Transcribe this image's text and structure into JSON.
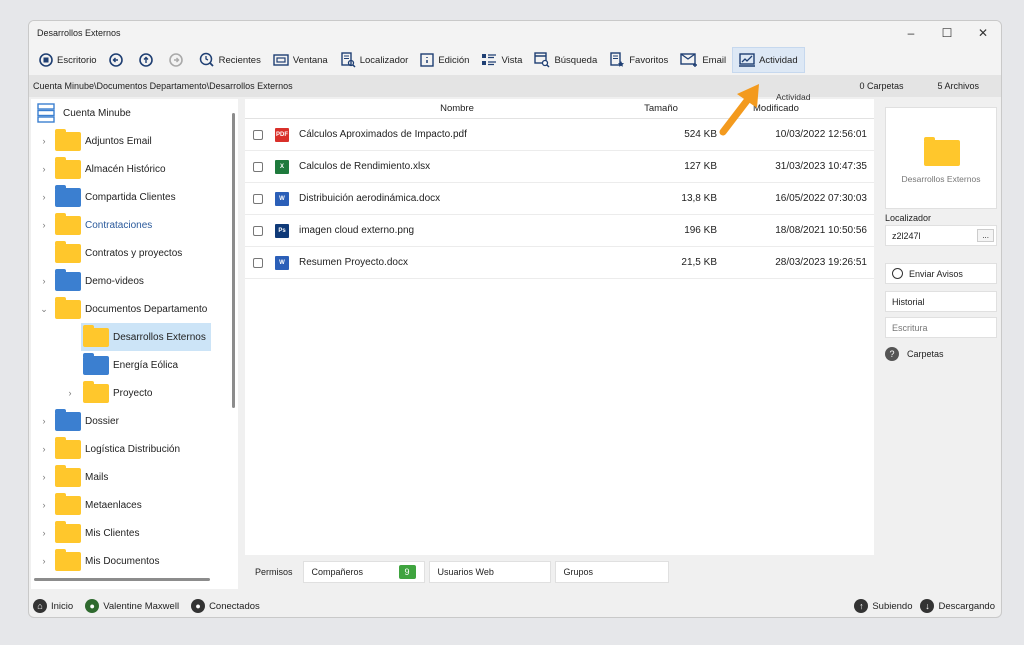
{
  "window": {
    "title": "Desarrollos Externos"
  },
  "toolbar": {
    "escritorio": "Escritorio",
    "recientes": "Recientes",
    "ventana": "Ventana",
    "localizador": "Localizador",
    "edicion": "Edición",
    "vista": "Vista",
    "busqueda": "Búsqueda",
    "favoritos": "Favoritos",
    "email": "Email",
    "actividad": "Actividad"
  },
  "tooltip": "Actividad",
  "path": {
    "text": "Cuenta Minube\\Documentos Departamento\\Desarrollos Externos",
    "carpetas": "0 Carpetas",
    "archivos": "5 Archivos"
  },
  "tree": {
    "root": "Cuenta Minube",
    "items": [
      {
        "label": "Adjuntos Email",
        "color": "y"
      },
      {
        "label": "Almacén Histórico",
        "color": "y"
      },
      {
        "label": "Compartida Clientes",
        "color": "b"
      },
      {
        "label": "Contrataciones",
        "color": "y"
      },
      {
        "label": "Contratos y proyectos",
        "color": "y"
      },
      {
        "label": "Demo-videos",
        "color": "b"
      },
      {
        "label": "Documentos Departamento",
        "color": "y"
      },
      {
        "label": "Desarrollos Externos",
        "color": "y"
      },
      {
        "label": "Energía Eólica",
        "color": "b"
      },
      {
        "label": "Proyecto",
        "color": "y"
      },
      {
        "label": "Dossier",
        "color": "b"
      },
      {
        "label": "Logística Distribución",
        "color": "y"
      },
      {
        "label": "Mails",
        "color": "y"
      },
      {
        "label": "Metaenlaces",
        "color": "y"
      },
      {
        "label": "Mis Clientes",
        "color": "y"
      },
      {
        "label": "Mis Documentos",
        "color": "y"
      }
    ]
  },
  "files": {
    "headers": {
      "name": "Nombre",
      "size": "Tamaño",
      "modified": "Modificado"
    },
    "rows": [
      {
        "name": "Cálculos Aproximados de Impacto.pdf",
        "size": "524 KB",
        "date": "10/03/2022 12:56:01",
        "type": "pdf"
      },
      {
        "name": "Calculos de Rendimiento.xlsx",
        "size": "127 KB",
        "date": "31/03/2023 10:47:35",
        "type": "xlsx"
      },
      {
        "name": "Distribuición aerodinámica.docx",
        "size": "13,8 KB",
        "date": "16/05/2022 07:30:03",
        "type": "docx"
      },
      {
        "name": "imagen cloud externo.png",
        "size": "196 KB",
        "date": "18/08/2021 10:50:56",
        "type": "ps"
      },
      {
        "name": "Resumen Proyecto.docx",
        "size": "21,5 KB",
        "date": "28/03/2023 19:26:51",
        "type": "docx"
      }
    ]
  },
  "bottomtabs": {
    "permisos": "Permisos",
    "companeros": "Compañeros",
    "companeros_count": "9",
    "usuarios": "Usuarios Web",
    "grupos": "Grupos"
  },
  "right": {
    "preview_label": "Desarrollos Externos",
    "localizador_label": "Localizador",
    "localizador_value": "z2l247l",
    "more": "...",
    "enviar": "Enviar Avisos",
    "historial": "Historial",
    "escritura": "Escritura",
    "carpetas": "Carpetas"
  },
  "status": {
    "inicio": "Inicio",
    "user": "Valentine Maxwell",
    "conectados": "Conectados",
    "subiendo": "Subiendo",
    "descargando": "Descargando"
  },
  "colors": {
    "yellow_folder": "#ffc72c",
    "blue_folder": "#3b7fd0",
    "accent": "#2a5a9c",
    "highlight": "#cce4f7",
    "arrow": "#f39a1e"
  }
}
